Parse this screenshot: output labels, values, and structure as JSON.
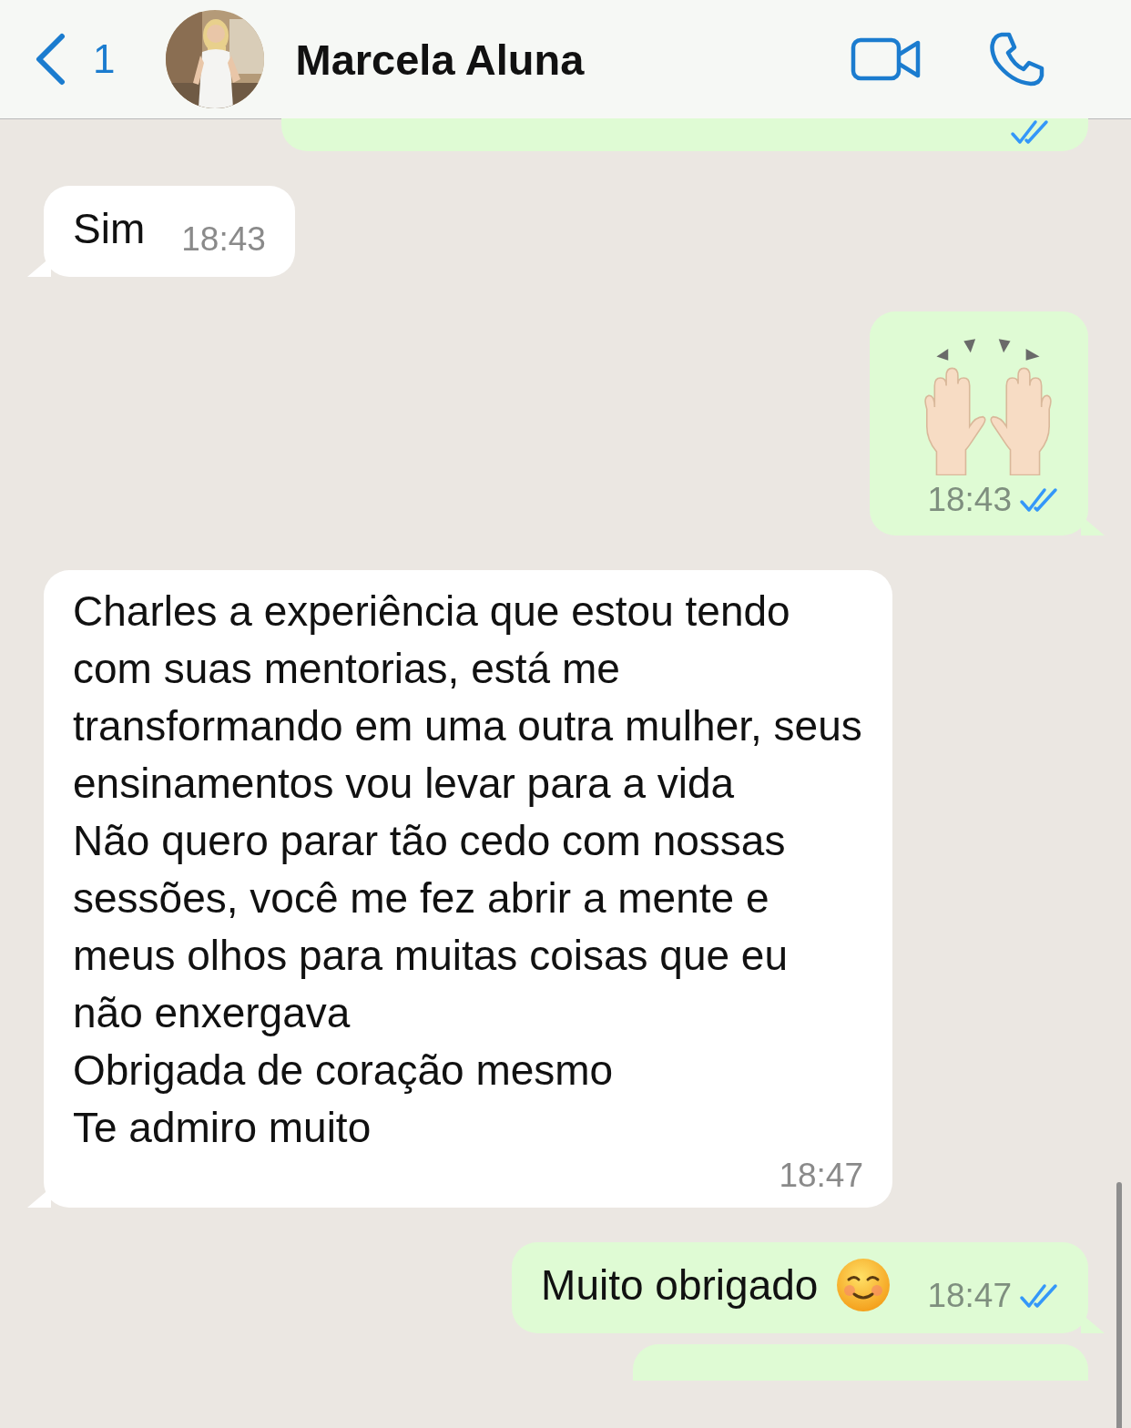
{
  "header": {
    "back_count": "1",
    "contact_name": "Marcela Aluna"
  },
  "messages": [
    {
      "kind": "partial",
      "outgoing": true,
      "read": true
    },
    {
      "kind": "text",
      "outgoing": false,
      "text": "Sim",
      "time": "18:43"
    },
    {
      "kind": "emoji",
      "outgoing": true,
      "time": "18:43",
      "read": true
    },
    {
      "kind": "text",
      "outgoing": false,
      "text": "Charles a experiência que estou tendo com suas mentorias, está me transformando em uma outra mulher, seus ensinamentos vou levar para a vida\nNão quero parar tão cedo com nossas sessões, você me fez abrir a mente e meus olhos para muitas coisas que eu não enxergava\nObrigada de coração mesmo\nTe admiro muito",
      "time": "18:47"
    },
    {
      "kind": "text_emoji",
      "outgoing": true,
      "text": "Muito obrigado",
      "time": "18:47",
      "read": true
    },
    {
      "kind": "partial",
      "outgoing": true
    }
  ]
}
